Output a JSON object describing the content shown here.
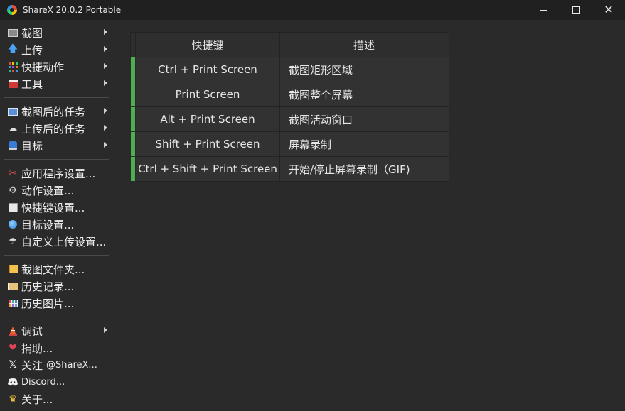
{
  "window": {
    "title": "ShareX 20.0.2 Portable",
    "controls": [
      "minimize",
      "maximize",
      "close"
    ]
  },
  "sidebar": {
    "groups": [
      [
        {
          "label": "截图",
          "icon": "screenshot-icon",
          "submenu": true
        },
        {
          "label": "上传",
          "icon": "upload-arrow-icon",
          "submenu": true
        },
        {
          "label": "快捷动作",
          "icon": "quick-actions-icon",
          "submenu": true
        },
        {
          "label": "工具",
          "icon": "toolbox-icon",
          "submenu": true
        }
      ],
      [
        {
          "label": "截图后的任务",
          "icon": "after-capture-icon",
          "submenu": true
        },
        {
          "label": "上传后的任务",
          "icon": "after-upload-icon",
          "submenu": true
        },
        {
          "label": "目标",
          "icon": "destinations-icon",
          "submenu": true
        }
      ],
      [
        {
          "label": "应用程序设置...",
          "icon": "app-settings-icon",
          "submenu": false
        },
        {
          "label": "动作设置...",
          "icon": "gear-icon",
          "submenu": false
        },
        {
          "label": "快捷键设置...",
          "icon": "keyboard-icon",
          "submenu": false
        },
        {
          "label": "目标设置...",
          "icon": "globe-icon",
          "submenu": false
        },
        {
          "label": "自定义上传设置...",
          "icon": "custom-uploader-icon",
          "submenu": false
        }
      ],
      [
        {
          "label": "截图文件夹...",
          "icon": "folder-icon",
          "submenu": false
        },
        {
          "label": "历史记录...",
          "icon": "history-icon",
          "submenu": false
        },
        {
          "label": "历史图片...",
          "icon": "image-history-icon",
          "submenu": false
        }
      ],
      [
        {
          "label": "调试",
          "icon": "debug-cone-icon",
          "submenu": true
        },
        {
          "label": "捐助...",
          "icon": "heart-icon",
          "submenu": false
        },
        {
          "label": "关注",
          "suffix": "@ShareX...",
          "icon": "x-logo-icon",
          "submenu": false
        },
        {
          "label": "Discord...",
          "icon": "discord-icon",
          "submenu": false
        },
        {
          "label": "关于...",
          "icon": "crown-icon",
          "submenu": false
        }
      ]
    ]
  },
  "hotkeys": {
    "headers": {
      "hotkey": "快捷键",
      "description": "描述"
    },
    "rows": [
      {
        "hotkey": "Ctrl + Print Screen",
        "description": "截图矩形区域"
      },
      {
        "hotkey": "Print Screen",
        "description": "截图整个屏幕"
      },
      {
        "hotkey": "Alt + Print Screen",
        "description": "截图活动窗口"
      },
      {
        "hotkey": "Shift + Print Screen",
        "description": "屏幕录制"
      },
      {
        "hotkey": "Ctrl + Shift + Print Screen",
        "description": "开始/停止屏幕录制（GIF)"
      }
    ]
  },
  "colors": {
    "background": "#2a2a2a",
    "titlebar": "#202020",
    "active_marker": "#4caf50"
  }
}
